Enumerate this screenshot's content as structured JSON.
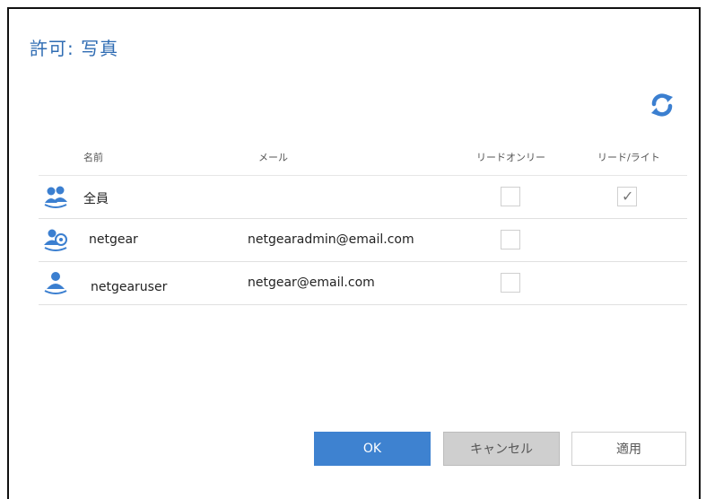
{
  "dialog": {
    "title": "許可: 写真"
  },
  "table": {
    "columns": {
      "name": "名前",
      "email": "メール",
      "read_only": "リードオンリー",
      "read_write": "リード/ライト"
    },
    "rows": [
      {
        "name": "全員",
        "email": "",
        "read_only": false,
        "read_write": true,
        "icon": "group-icon"
      },
      {
        "name": "netgear",
        "email": "netgearadmin@email.com",
        "read_only": false,
        "read_write": null,
        "icon": "admin-user-icon"
      },
      {
        "name": "netgearuser",
        "email": "netgear@email.com",
        "read_only": false,
        "read_write": null,
        "icon": "user-icon"
      }
    ]
  },
  "buttons": {
    "ok": "OK",
    "cancel": "キャンセル",
    "apply": "適用"
  },
  "colors": {
    "accent": "#3e82d0",
    "title": "#2f6cb3",
    "icon": "#3b7fd0"
  }
}
